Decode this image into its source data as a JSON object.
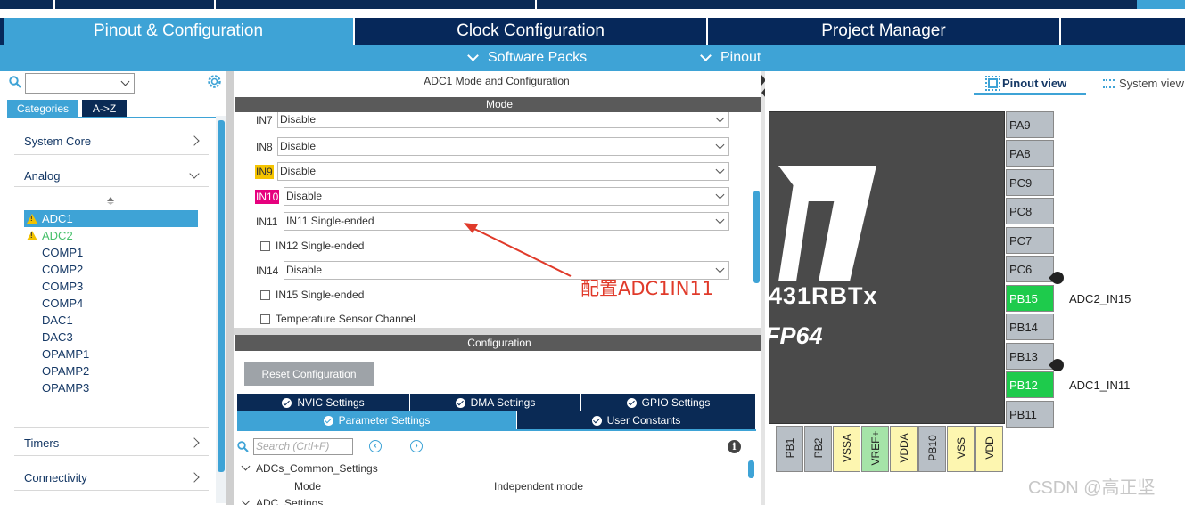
{
  "tabs": {
    "pinout": "Pinout & Configuration",
    "clock": "Clock Configuration",
    "project": "Project Manager"
  },
  "subbar": {
    "software_packs": "Software Packs",
    "pinout": "Pinout"
  },
  "left": {
    "cat_tab": "Categories",
    "az_tab": "A->Z",
    "sections": [
      "System Core",
      "Analog",
      "Timers",
      "Connectivity"
    ],
    "analog_items": [
      "ADC1",
      "ADC2",
      "COMP1",
      "COMP2",
      "COMP3",
      "COMP4",
      "DAC1",
      "DAC3",
      "OPAMP1",
      "OPAMP2",
      "OPAMP3"
    ]
  },
  "middle": {
    "title": "ADC1 Mode and Configuration",
    "mode_header": "Mode",
    "mode_rows": [
      {
        "label": "IN7",
        "value": "Disable"
      },
      {
        "label": "IN8",
        "value": "Disable"
      },
      {
        "label": "IN9",
        "value": "Disable"
      },
      {
        "label": "IN10",
        "value": "Disable"
      },
      {
        "label": "IN11",
        "value": "IN11 Single-ended"
      },
      {
        "label": "IN14",
        "value": "Disable"
      }
    ],
    "checks": [
      "IN12 Single-ended",
      "IN15 Single-ended",
      "Temperature Sensor Channel"
    ],
    "config_header": "Configuration",
    "reset_button": "Reset Configuration",
    "settings_tabs": [
      "NVIC Settings",
      "DMA Settings",
      "GPIO Settings",
      "Parameter Settings",
      "User Constants"
    ],
    "search_placeholder": "Search (Crtl+F)",
    "params": {
      "group1": "ADCs_Common_Settings",
      "mode_label": "Mode",
      "mode_value": "Independent mode",
      "group2": "ADC_Settings"
    }
  },
  "annotation": "配置ADC1IN11",
  "right": {
    "pinout_view": "Pinout view",
    "system_view": "System view",
    "chip_name": "431RBTx",
    "package": "FP64",
    "pins_right": [
      "PA9",
      "PA8",
      "PC9",
      "PC8",
      "PC7",
      "PC6",
      "PB15",
      "PB14",
      "PB13",
      "PB12",
      "PB11"
    ],
    "pin_labels": {
      "PB15": "ADC2_IN15",
      "PB12": "ADC1_IN11"
    },
    "pins_bottom": [
      "PB1",
      "PB2",
      "VSSA",
      "VREF+",
      "VDDA",
      "PB10",
      "VSS",
      "VDD"
    ],
    "watermark": "CSDN @高正坚"
  }
}
